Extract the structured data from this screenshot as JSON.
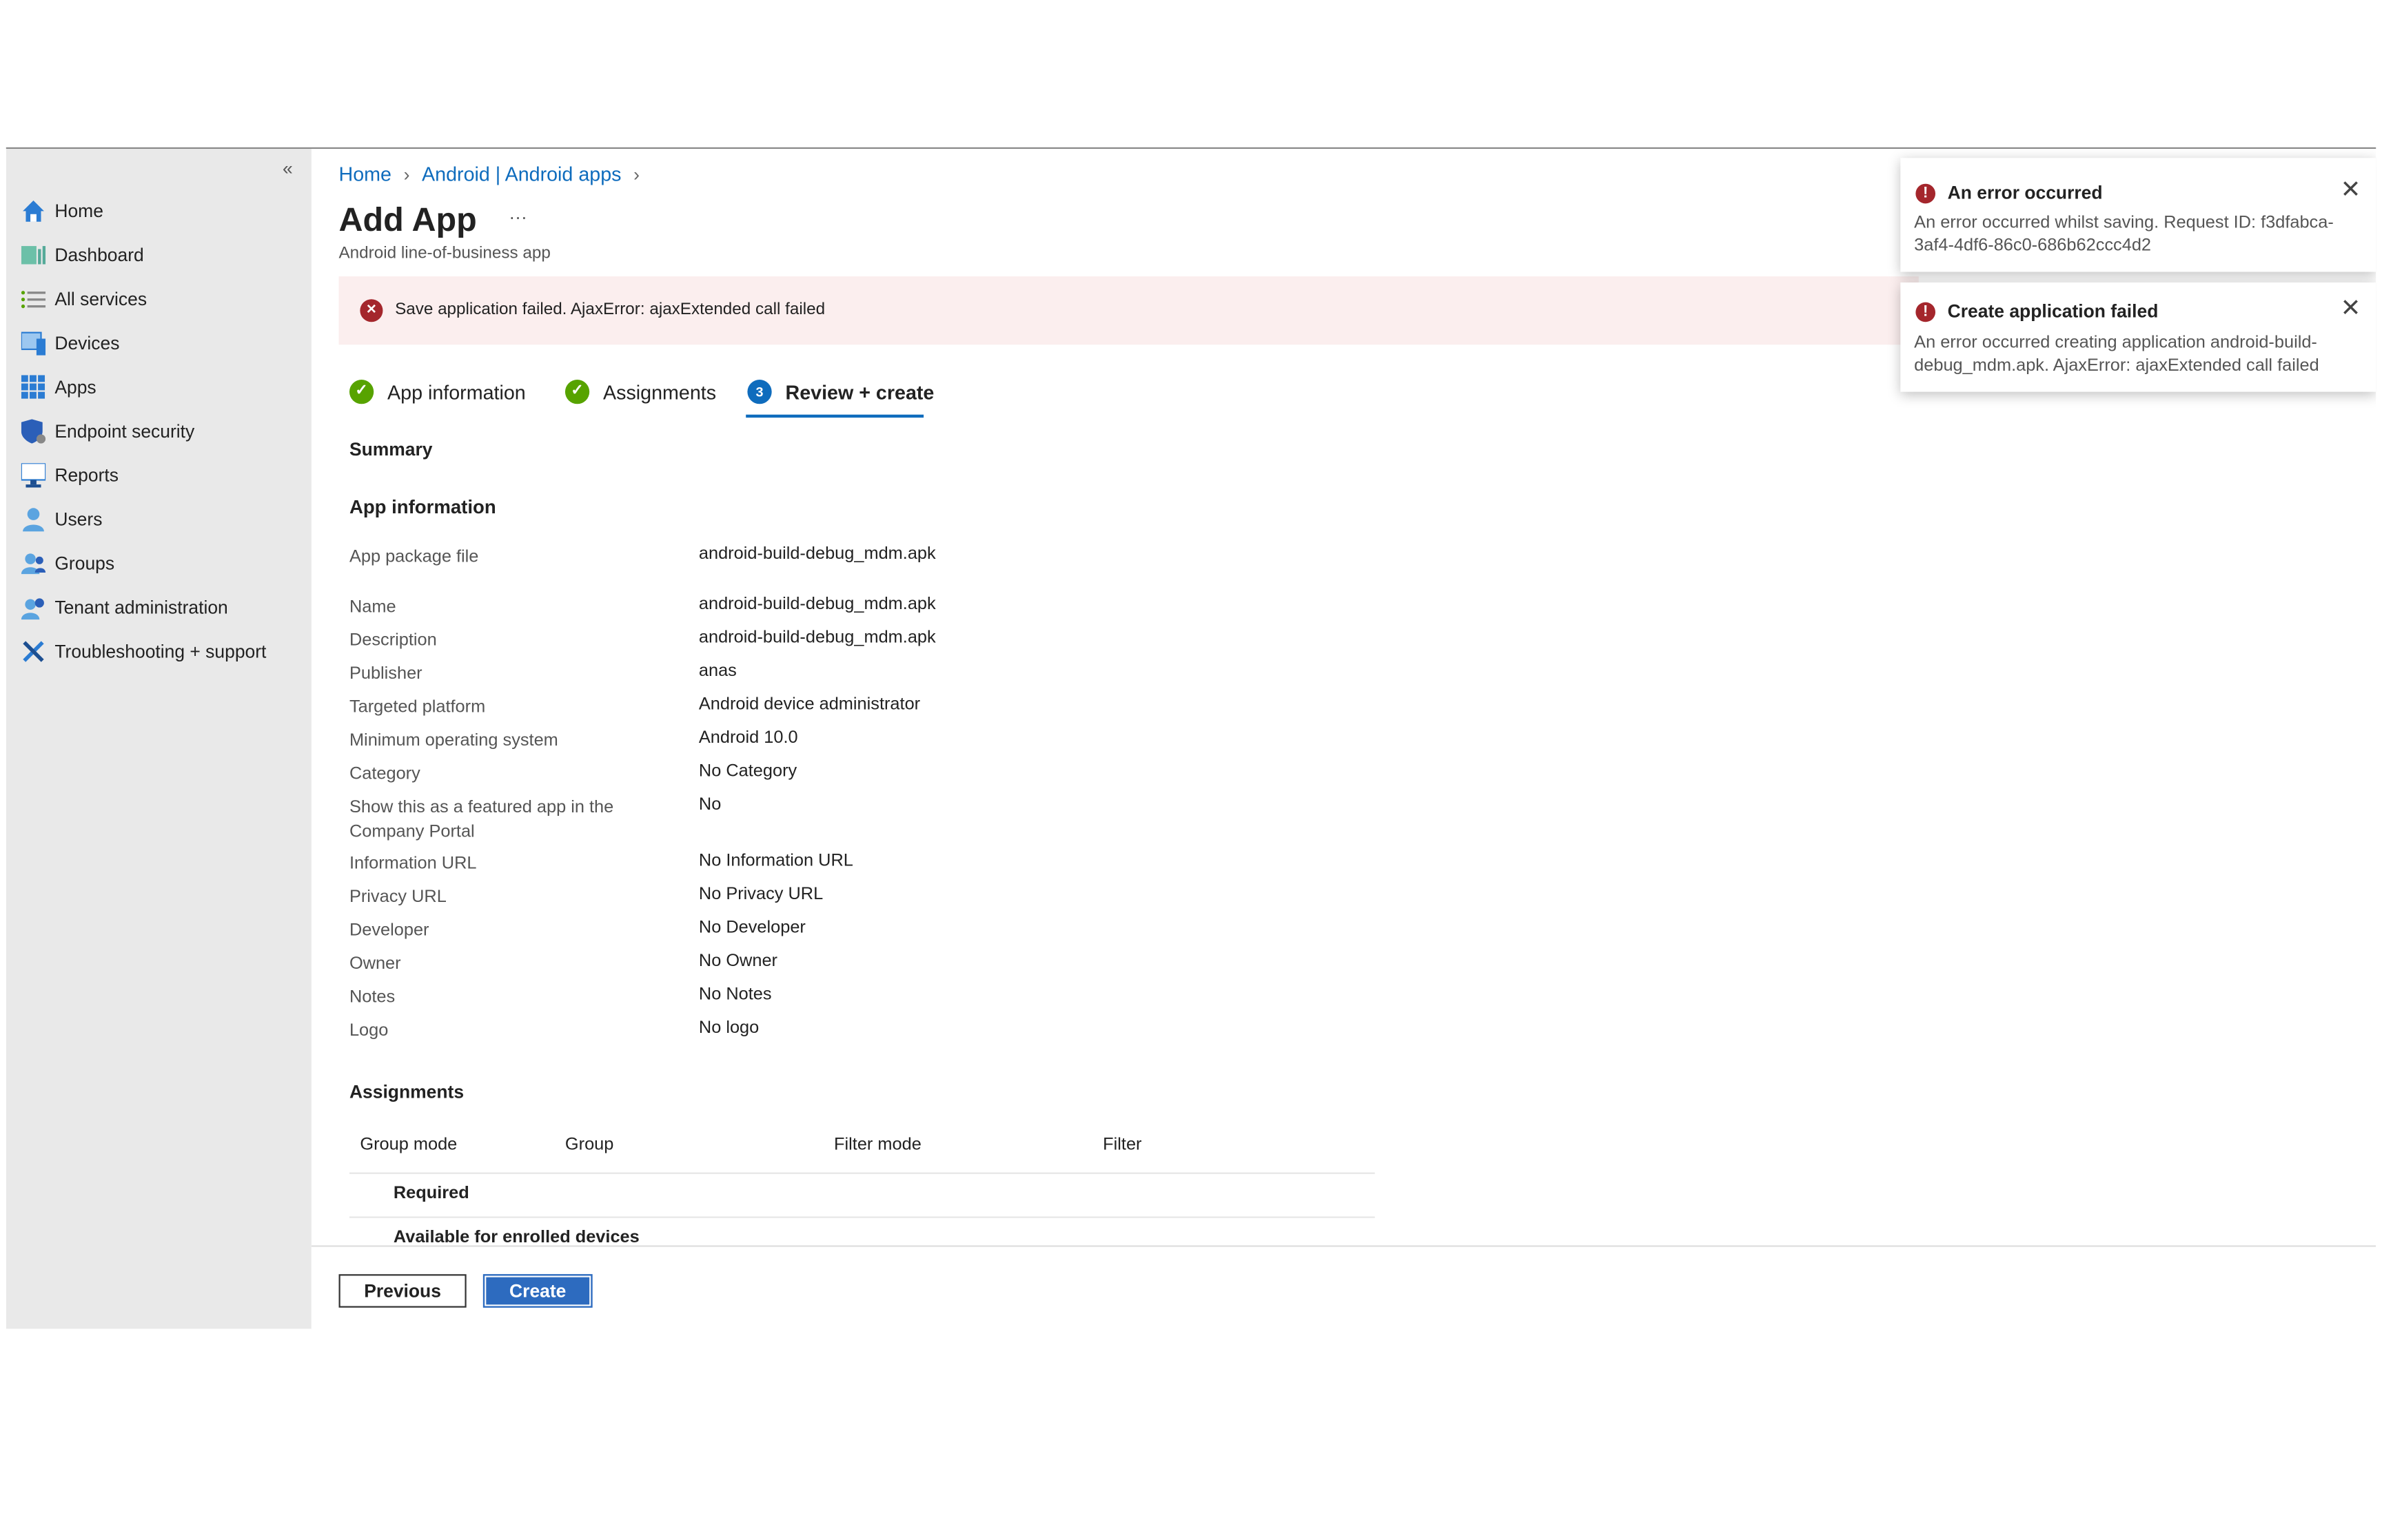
{
  "sidebar": {
    "collapse_icon": "double-chevron-left",
    "items": [
      {
        "label": "Home",
        "icon": "home-icon"
      },
      {
        "label": "Dashboard",
        "icon": "dashboard-icon"
      },
      {
        "label": "All services",
        "icon": "list-icon"
      },
      {
        "label": "Devices",
        "icon": "devices-icon"
      },
      {
        "label": "Apps",
        "icon": "apps-grid-icon"
      },
      {
        "label": "Endpoint security",
        "icon": "shield-icon"
      },
      {
        "label": "Reports",
        "icon": "reports-icon"
      },
      {
        "label": "Users",
        "icon": "user-icon"
      },
      {
        "label": "Groups",
        "icon": "groups-icon"
      },
      {
        "label": "Tenant administration",
        "icon": "tenant-admin-icon"
      },
      {
        "label": "Troubleshooting + support",
        "icon": "tools-icon"
      }
    ]
  },
  "breadcrumb": [
    "Home",
    "Android | Android apps"
  ],
  "header": {
    "title": "Add App",
    "more": "···",
    "subtitle": "Android line-of-business app"
  },
  "banner": {
    "text": "Save application failed. AjaxError: ajaxExtended call failed"
  },
  "steps": [
    {
      "label": "App information",
      "state": "done"
    },
    {
      "label": "Assignments",
      "state": "done"
    },
    {
      "label": "Review + create",
      "number": "3",
      "state": "active"
    }
  ],
  "summary": {
    "heading": "Summary",
    "app_info_heading": "App information",
    "fields": [
      {
        "label": "App package file",
        "value": "android-build-debug_mdm.apk"
      },
      {
        "label": "Name",
        "value": "android-build-debug_mdm.apk"
      },
      {
        "label": "Description",
        "value": "android-build-debug_mdm.apk"
      },
      {
        "label": "Publisher",
        "value": "anas"
      },
      {
        "label": "Targeted platform",
        "value": "Android device administrator"
      },
      {
        "label": "Minimum operating system",
        "value": "Android 10.0"
      },
      {
        "label": "Category",
        "value": "No Category"
      },
      {
        "label": "Show this as a featured app in the Company Portal",
        "value": "No"
      },
      {
        "label": "Information URL",
        "value": "No Information URL"
      },
      {
        "label": "Privacy URL",
        "value": "No Privacy URL"
      },
      {
        "label": "Developer",
        "value": "No Developer"
      },
      {
        "label": "Owner",
        "value": "No Owner"
      },
      {
        "label": "Notes",
        "value": "No Notes"
      },
      {
        "label": "Logo",
        "value": "No logo"
      }
    ]
  },
  "assignments": {
    "heading": "Assignments",
    "columns": [
      "Group mode",
      "Group",
      "Filter mode",
      "Filter"
    ],
    "rows": [
      "Required",
      "Available for enrolled devices"
    ]
  },
  "footer": {
    "previous": "Previous",
    "create": "Create"
  },
  "toasts": [
    {
      "title": "An error occurred",
      "message": "An error occurred whilst saving. Request ID: f3dfabca-3af4-4df6-86c0-686b62ccc4d2"
    },
    {
      "title": "Create application failed",
      "message": "An error occurred creating application android-build-debug_mdm.apk. AjaxError: ajaxExtended call failed"
    }
  ],
  "colors": {
    "accent": "#0f6cbd",
    "error": "#a4262c",
    "success": "#57a300",
    "banner_bg": "#fbeeee"
  }
}
